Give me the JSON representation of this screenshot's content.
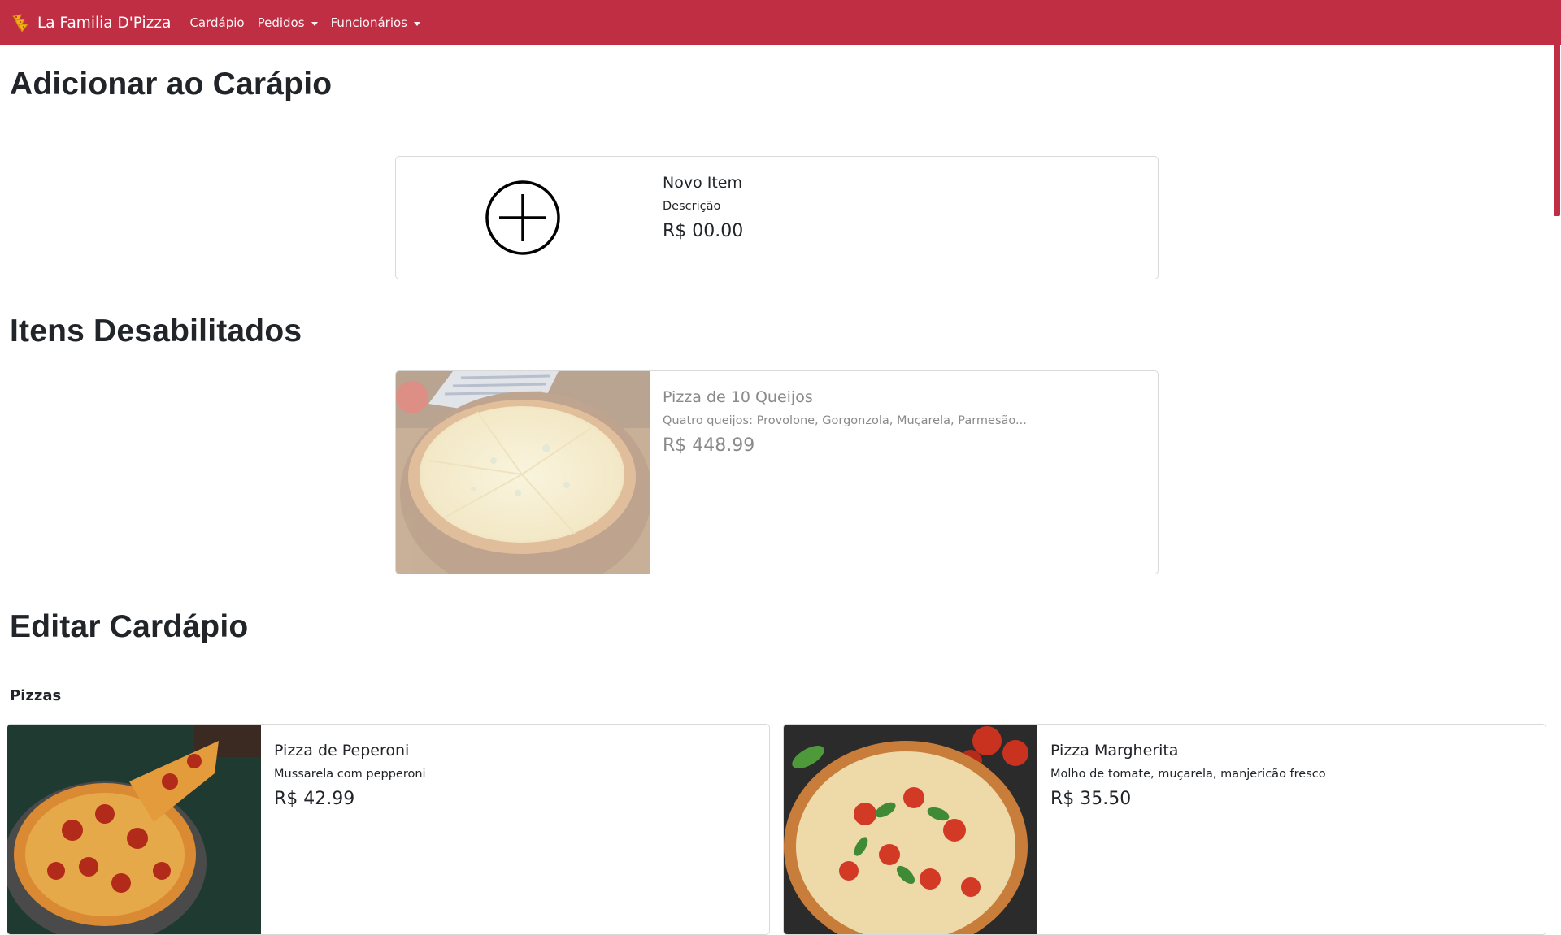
{
  "navbar": {
    "brand": "La Familia D'Pizza",
    "links": [
      {
        "label": "Cardápio"
      },
      {
        "label": "Pedidos"
      },
      {
        "label": "Funcionários"
      }
    ]
  },
  "sections": {
    "add": {
      "title": "Adicionar ao Carápio",
      "card": {
        "name": "Novo Item",
        "description": "Descrição",
        "price": "R$ 00.00"
      }
    },
    "disabled": {
      "title": "Itens Desabilitados",
      "items": [
        {
          "name": "Pizza de 10 Queijos",
          "description": "Quatro queijos: Provolone, Gorgonzola, Muçarela, Parmesão...",
          "price": "R$ 448.99"
        }
      ]
    },
    "edit": {
      "title": "Editar Cardápio",
      "category": "Pizzas",
      "items": [
        {
          "name": "Pizza de Peperoni",
          "description": "Mussarela com pepperoni",
          "price": "R$ 42.99"
        },
        {
          "name": "Pizza Margherita",
          "description": "Molho de tomate, muçarela, manjericão fresco",
          "price": "R$ 35.50"
        }
      ]
    }
  },
  "colors": {
    "navbar": "#c02e44",
    "text": "#212529",
    "disabled_text": "#8a8a8a"
  },
  "icons": {
    "brand": "pizza-slices-icon",
    "add": "plus-circle-icon",
    "dropdown": "caret-down-icon"
  }
}
